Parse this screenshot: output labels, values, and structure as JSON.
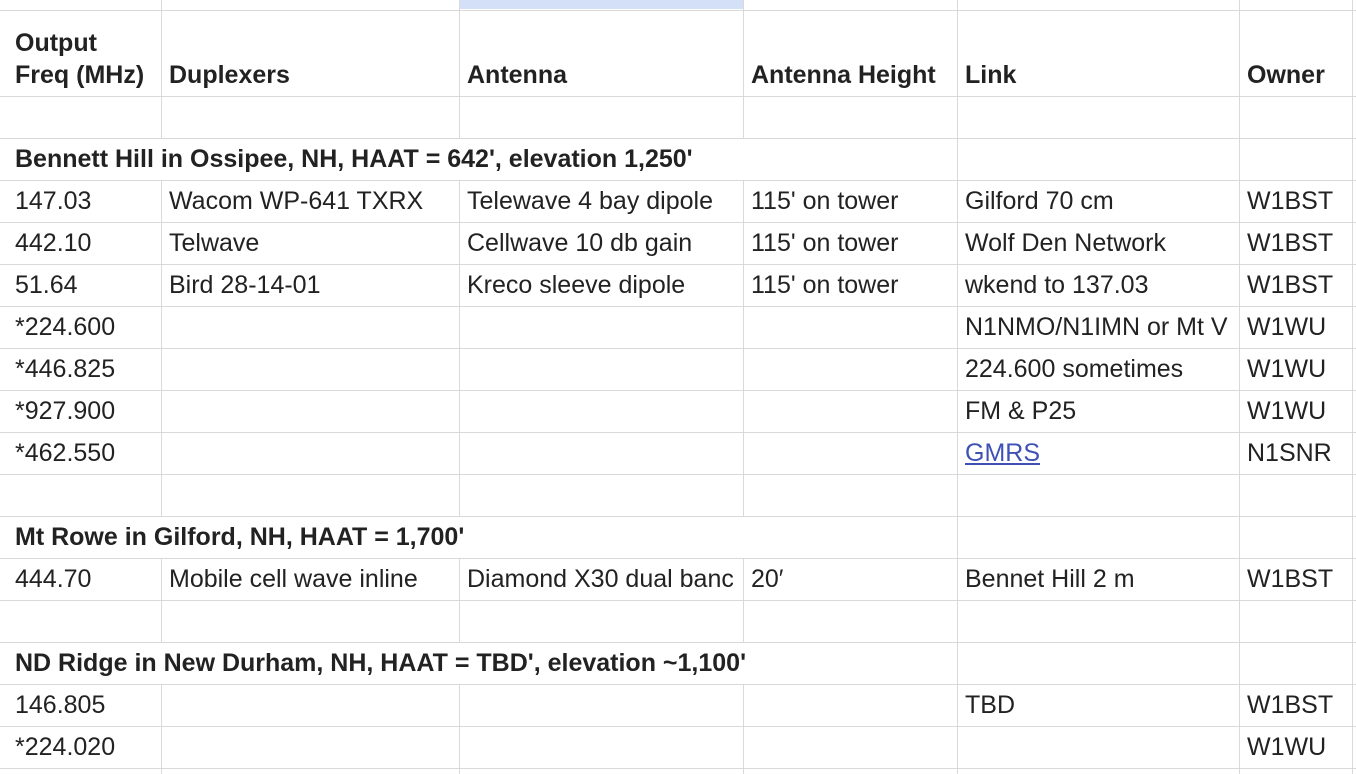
{
  "headers": {
    "freq_line1": "Output",
    "freq_line2": "Freq (MHz)",
    "duplexers": "Duplexers",
    "antenna": "Antenna",
    "antenna_height": "Antenna Height",
    "link": "Link",
    "owner": "Owner"
  },
  "sections": [
    {
      "title": "Bennett Hill in Ossipee, NH, HAAT = 642', elevation 1,250'",
      "rows": [
        {
          "freq": "147.03",
          "duplexer": "Wacom WP-641 TXRX",
          "antenna": "Telewave 4 bay dipole",
          "height": "115' on tower",
          "link": "Gilford 70 cm",
          "owner": "W1BST"
        },
        {
          "freq": "442.10",
          "duplexer": "Telwave",
          "antenna": "Cellwave 10 db gain",
          "height": "115' on tower",
          "link": "Wolf Den Network",
          "owner": "W1BST"
        },
        {
          "freq": "51.64",
          "duplexer": "Bird 28-14-01",
          "antenna": "Kreco sleeve dipole",
          "height": "115' on tower",
          "link": "wkend to 137.03",
          "owner": "W1BST"
        },
        {
          "freq": "*224.600",
          "duplexer": "",
          "antenna": "",
          "height": "",
          "link": "N1NMO/N1IMN or Mt V",
          "owner": "W1WU"
        },
        {
          "freq": "*446.825",
          "duplexer": "",
          "antenna": "",
          "height": "",
          "link": "224.600 sometimes",
          "owner": "W1WU"
        },
        {
          "freq": "*927.900",
          "duplexer": "",
          "antenna": "",
          "height": "",
          "link": "FM & P25",
          "owner": "W1WU"
        },
        {
          "freq": "*462.550",
          "duplexer": "",
          "antenna": "",
          "height": "",
          "link": "GMRS",
          "owner": "N1SNR"
        }
      ]
    },
    {
      "title": "Mt Rowe in Gilford, NH, HAAT = 1,700'",
      "rows": [
        {
          "freq": "444.70",
          "duplexer": "Mobile cell wave inline",
          "antenna": "Diamond X30 dual banc",
          "height": "20′",
          "link": "Bennet Hill 2 m",
          "owner": "W1BST"
        }
      ]
    },
    {
      "title": "ND Ridge in New Durham, NH, HAAT = TBD', elevation ~1,100'",
      "rows": [
        {
          "freq": "146.805",
          "duplexer": "",
          "antenna": "",
          "height": "",
          "link": "TBD",
          "owner": "W1BST"
        },
        {
          "freq": "*224.020",
          "duplexer": "",
          "antenna": "",
          "height": "",
          "link": "",
          "owner": "W1WU"
        }
      ]
    }
  ],
  "colors": {
    "gridline": "#d9d9d9",
    "text": "#222222",
    "link": "#3f51b5",
    "selected_column_strip": "#d3e0f7"
  }
}
